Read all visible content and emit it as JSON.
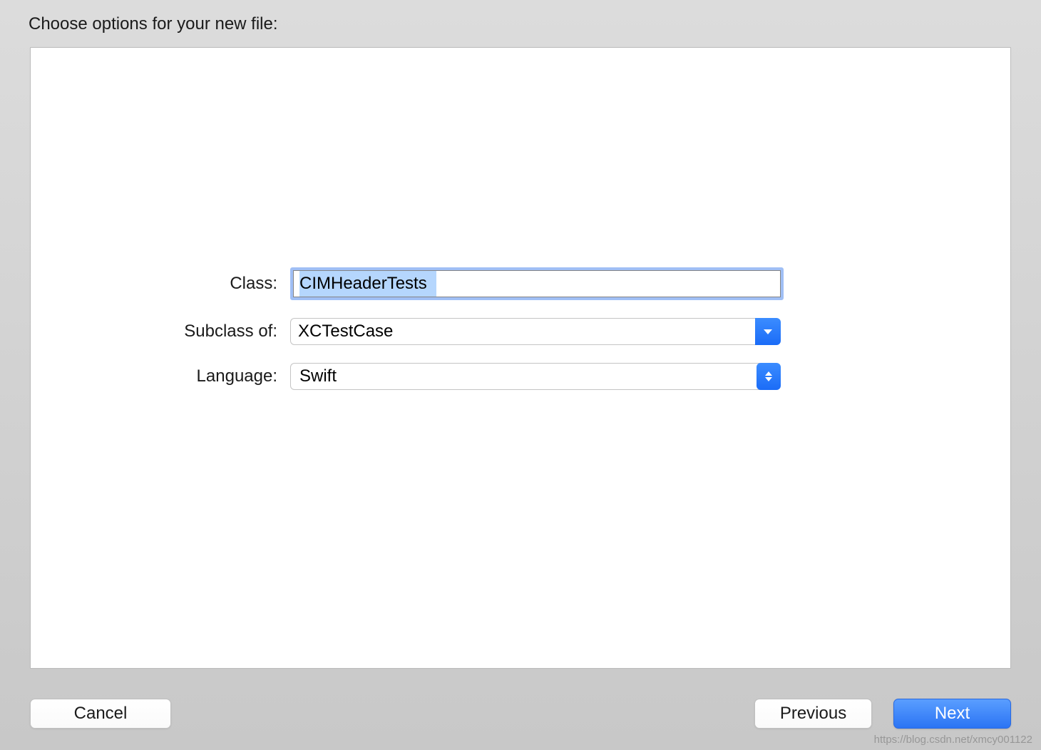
{
  "dialog": {
    "title": "Choose options for your new file:"
  },
  "form": {
    "class": {
      "label": "Class:",
      "value": "CIMHeaderTests"
    },
    "subclass": {
      "label": "Subclass of:",
      "value": "XCTestCase"
    },
    "language": {
      "label": "Language:",
      "value": "Swift"
    }
  },
  "buttons": {
    "cancel": "Cancel",
    "previous": "Previous",
    "next": "Next"
  },
  "watermark": "https://blog.csdn.net/xmcy001122"
}
